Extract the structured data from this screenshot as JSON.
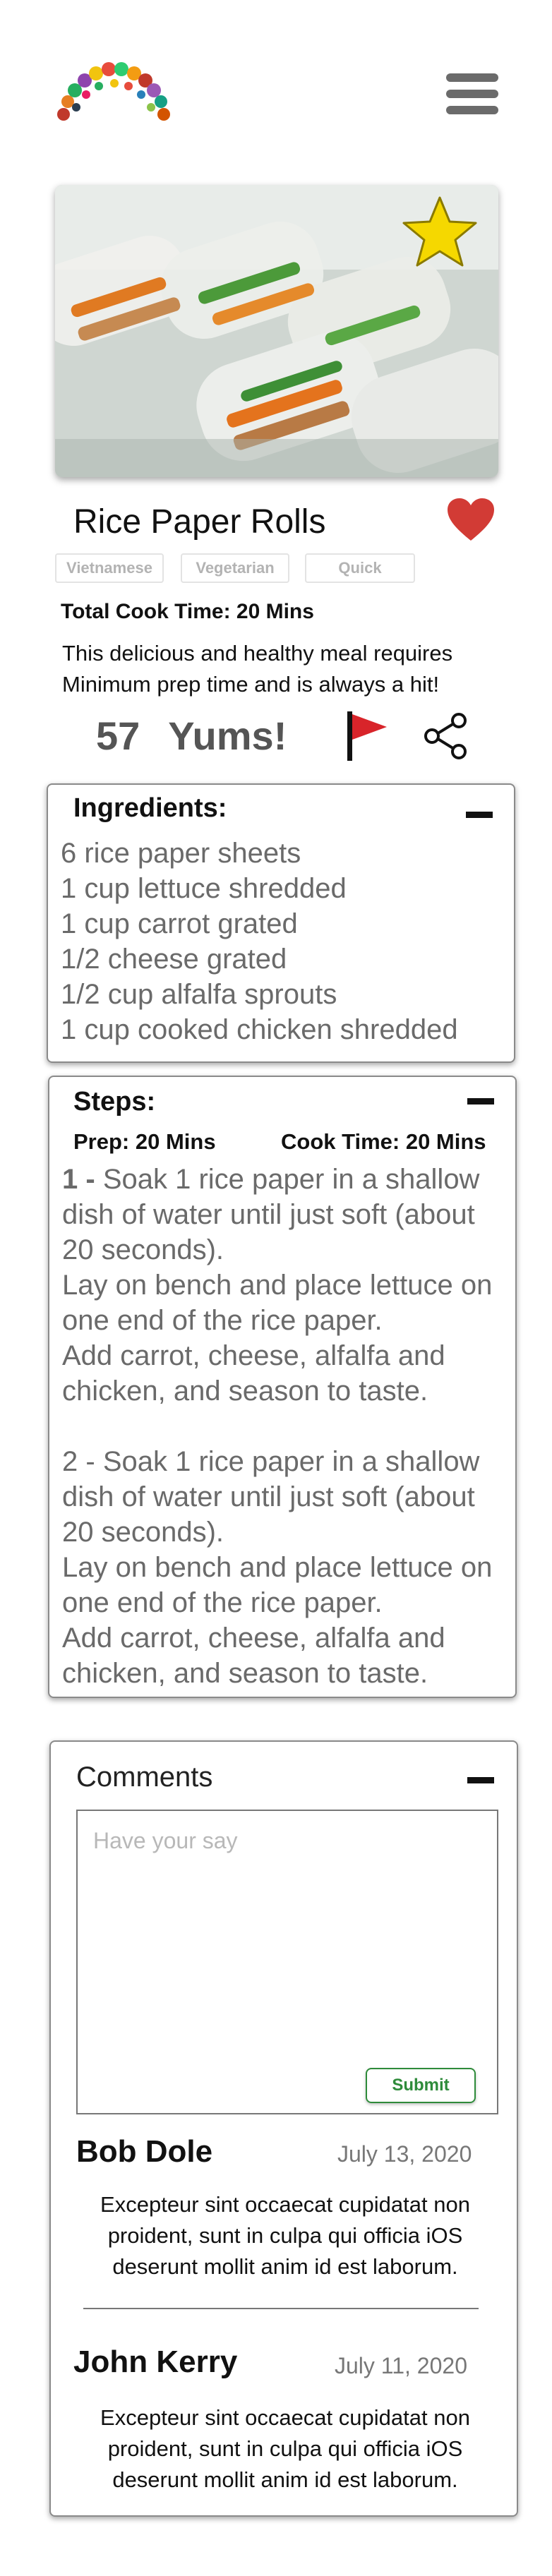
{
  "recipe": {
    "title": "Rice Paper Rolls",
    "tags": [
      "Vietnamese",
      "Vegetarian",
      "Quick"
    ],
    "total_cook_time": "Total Cook Time: 20 Mins",
    "description": "This delicious and healthy meal requires Minimum prep time and is always a hit!",
    "yums_count": "57",
    "yums_label": "Yums!"
  },
  "icons": {
    "menu": "hamburger-menu-icon",
    "favorite": "star-icon",
    "like": "heart-icon",
    "report": "flag-icon",
    "share": "share-icon",
    "collapse": "minus-icon"
  },
  "colors": {
    "heart": "#d23b35",
    "flag": "#d8242a",
    "star": "#f5d800",
    "submit": "#2e8b3a"
  },
  "ingredients": {
    "heading": "Ingredients:",
    "items": [
      "6 rice paper sheets",
      "1 cup lettuce shredded",
      "1 cup carrot grated",
      "1/2 cheese grated",
      "1/2 cup alfalfa sprouts",
      "1 cup cooked chicken shredded"
    ]
  },
  "steps": {
    "heading": "Steps:",
    "prep": "Prep: 20 Mins",
    "cook": "Cook Time: 20 Mins",
    "items": [
      {
        "num": "1 -",
        "text": "Soak 1 rice paper in a shallow dish of water until just soft (about 20 seconds).\nLay on bench and place lettuce on one end of the rice paper.\nAdd carrot, cheese, alfalfa and chicken, and season to taste."
      },
      {
        "num": "2 -",
        "text": "Soak 1 rice paper in a shallow dish of water until just soft (about 20 seconds).\nLay on bench and place lettuce on one end of the rice paper.\nAdd carrot, cheese, alfalfa and chicken, and season to taste."
      }
    ]
  },
  "comments": {
    "heading": "Comments",
    "placeholder": "Have your say",
    "submit_label": "Submit",
    "items": [
      {
        "name": "Bob Dole",
        "date": "July 13, 2020",
        "body": "Excepteur sint occaecat cupidatat non proident, sunt in culpa qui officia iOS deserunt mollit anim id est laborum."
      },
      {
        "name": "John Kerry",
        "date": "July 11, 2020",
        "body": "Excepteur sint occaecat cupidatat non proident, sunt in culpa qui officia iOS deserunt mollit anim id est laborum."
      }
    ]
  }
}
